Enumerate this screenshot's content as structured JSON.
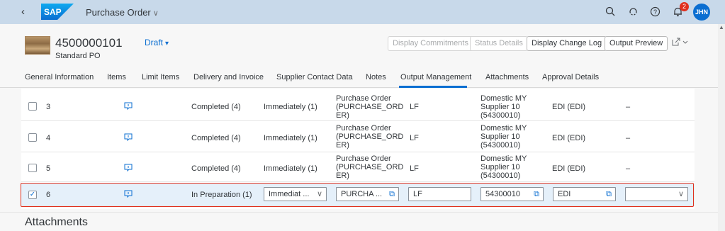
{
  "shell": {
    "back_icon": "‹",
    "logo_text": "SAP",
    "app_title": "Purchase Order",
    "title_chevron": "∨",
    "notifications_count": "2",
    "avatar_initials": "JHN"
  },
  "header": {
    "id": "4500000101",
    "type": "Standard PO",
    "draft_label": "Draft",
    "buttons": {
      "display_commitments": "Display Commitments",
      "status_details": "Status Details",
      "display_change_log": "Display Change Log",
      "output_preview": "Output Preview"
    }
  },
  "tabs": [
    {
      "label": "General Information"
    },
    {
      "label": "Items"
    },
    {
      "label": "Limit Items"
    },
    {
      "label": "Delivery and Invoice"
    },
    {
      "label": "Supplier Contact Data"
    },
    {
      "label": "Notes"
    },
    {
      "label": "Output Management",
      "active": true
    },
    {
      "label": "Attachments"
    },
    {
      "label": "Approval Details"
    }
  ],
  "table": {
    "rows": [
      {
        "num": "3",
        "status": "Completed (4)",
        "timing": "Immediately (1)",
        "doc_l1": "Purchase Order",
        "doc_l2": "(PURCHASE_ORD",
        "doc_l3": "ER)",
        "lang": "LF",
        "sup_l1": "Domestic MY",
        "sup_l2": "Supplier 10",
        "sup_l3": "(54300010)",
        "channel": "EDI (EDI)",
        "extra": "–"
      },
      {
        "num": "4",
        "status": "Completed (4)",
        "timing": "Immediately (1)",
        "doc_l1": "Purchase Order",
        "doc_l2": "(PURCHASE_ORD",
        "doc_l3": "ER)",
        "lang": "LF",
        "sup_l1": "Domestic MY",
        "sup_l2": "Supplier 10",
        "sup_l3": "(54300010)",
        "channel": "EDI (EDI)",
        "extra": "–"
      },
      {
        "num": "5",
        "status": "Completed (4)",
        "timing": "Immediately (1)",
        "doc_l1": "Purchase Order",
        "doc_l2": "(PURCHASE_ORD",
        "doc_l3": "ER)",
        "lang": "LF",
        "sup_l1": "Domestic MY",
        "sup_l2": "Supplier 10",
        "sup_l3": "(54300010)",
        "channel": "EDI (EDI)",
        "extra": "–"
      }
    ],
    "edit_row": {
      "num": "6",
      "checked": true,
      "status": "In Preparation (1)",
      "timing_value": "Immediat ...",
      "doc_value": "PURCHA ...",
      "lang_value": "LF",
      "supplier_value": "54300010",
      "channel_value": "EDI",
      "extra_value": ""
    }
  },
  "section": {
    "attachments_title": "Attachments"
  }
}
